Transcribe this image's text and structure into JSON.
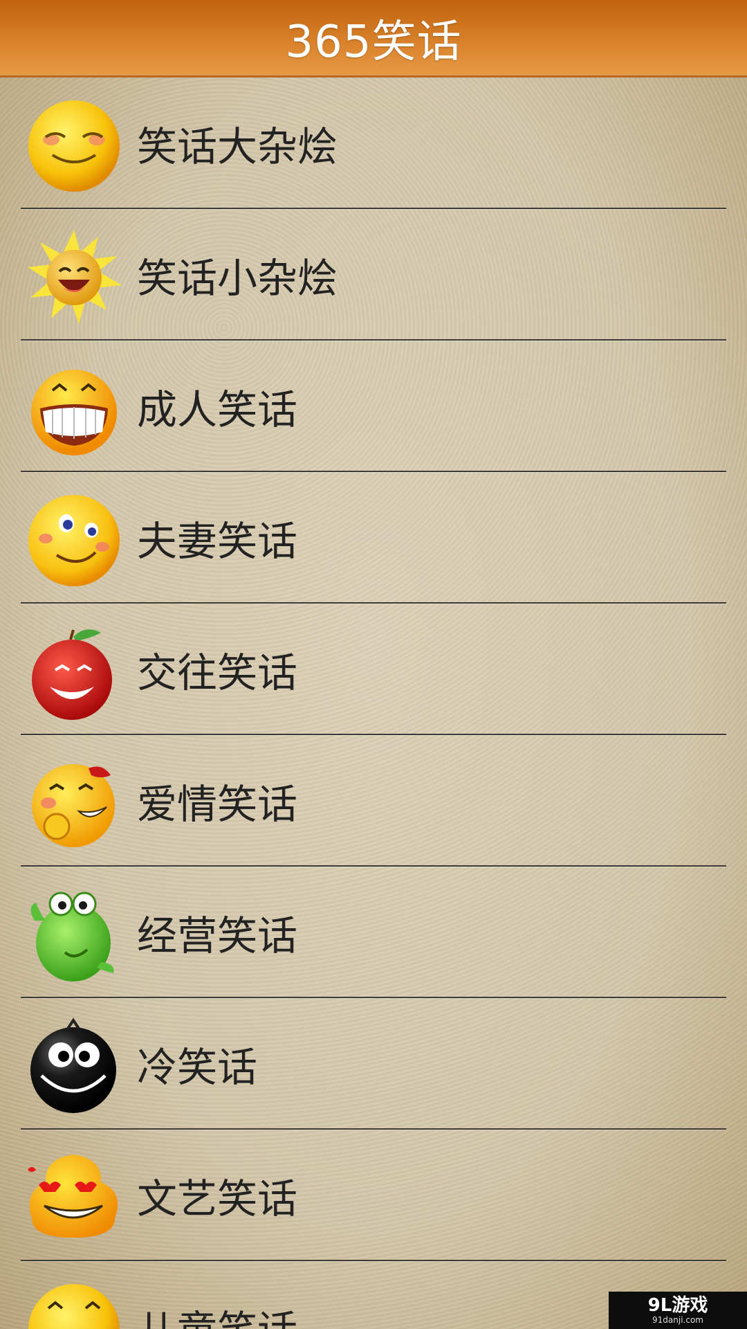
{
  "header": {
    "title": "365笑话"
  },
  "categories": [
    {
      "label": "笑话大杂烩",
      "icon": "smiling-face-icon"
    },
    {
      "label": "笑话小杂烩",
      "icon": "sun-laughing-icon"
    },
    {
      "label": "成人笑话",
      "icon": "grinning-teeth-icon"
    },
    {
      "label": "夫妻笑话",
      "icon": "winking-face-icon"
    },
    {
      "label": "交往笑话",
      "icon": "apple-face-icon"
    },
    {
      "label": "爱情笑话",
      "icon": "shy-face-icon"
    },
    {
      "label": "经营笑话",
      "icon": "green-frog-icon"
    },
    {
      "label": "冷笑话",
      "icon": "black-ball-face-icon"
    },
    {
      "label": "文艺笑话",
      "icon": "heart-eyes-blob-icon"
    },
    {
      "label": "儿童笑话",
      "icon": "smiling-face-icon"
    }
  ],
  "watermark": {
    "main": "9L游戏",
    "sub": "91danji.com"
  }
}
